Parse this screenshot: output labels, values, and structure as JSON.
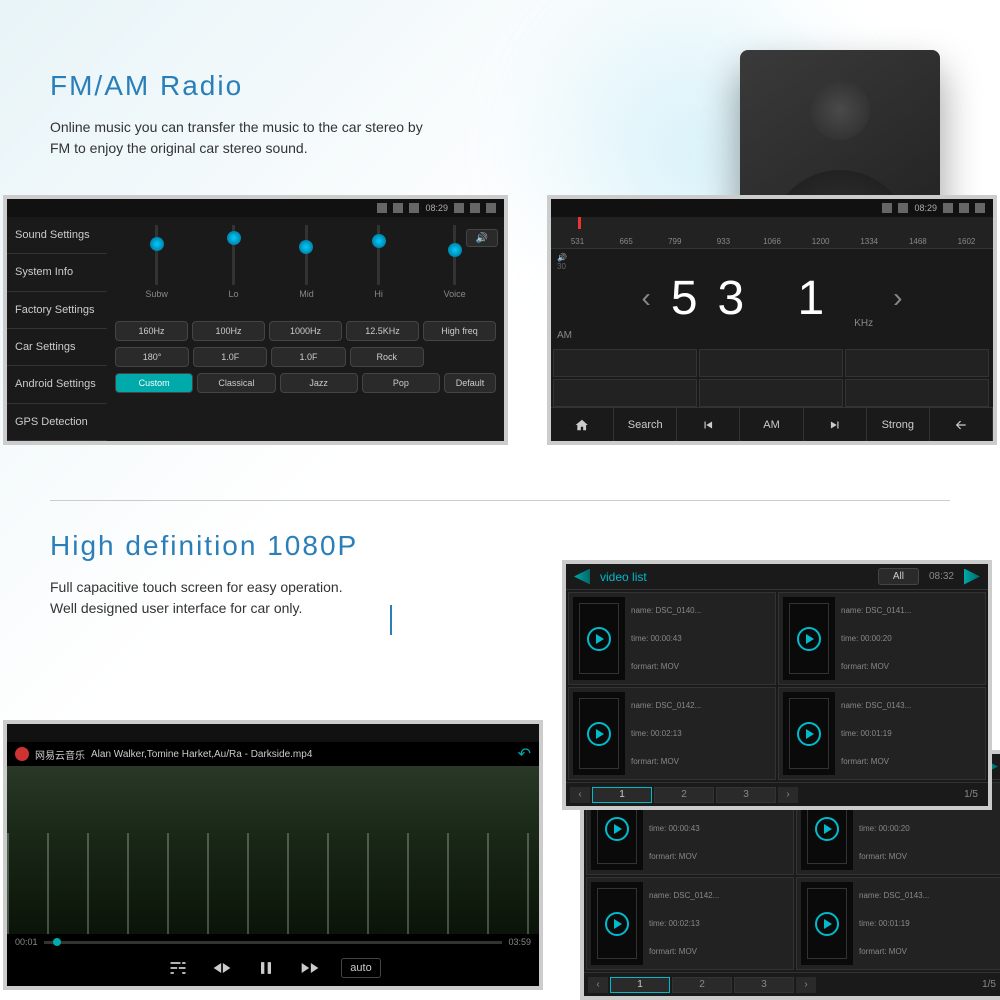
{
  "section1": {
    "title": "FM/AM Radio",
    "desc": "Online music you can transfer the music to the car stereo by FM to enjoy the original car stereo sound."
  },
  "section2": {
    "title": "High definition 1080P",
    "desc": "Full capacitive touch screen for easy operation.\nWell designed user interface for car only."
  },
  "status": {
    "time": "08:29"
  },
  "eq": {
    "side": [
      "Sound Settings",
      "System Info",
      "Factory Settings",
      "Car Settings",
      "Android Settings",
      "GPS Detection"
    ],
    "sliders": [
      "Subw",
      "Lo",
      "Mid",
      "Hi",
      "Voice"
    ],
    "row1": [
      "160Hz",
      "100Hz",
      "1000Hz",
      "12.5KHz",
      "High freq"
    ],
    "row2": [
      "180°",
      "1.0F",
      "1.0F",
      "Rock"
    ],
    "row3": [
      "Custom",
      "Classical",
      "Jazz",
      "Pop"
    ],
    "default": "Default"
  },
  "radio": {
    "ticks": [
      "531",
      "665",
      "799",
      "933",
      "1066",
      "1200",
      "1334",
      "1468",
      "1602"
    ],
    "vol": "30",
    "band": "AM",
    "freq": "53 1",
    "unit": "KHz",
    "controls": {
      "search": "Search",
      "am": "AM",
      "strong": "Strong"
    }
  },
  "video": {
    "brand": "网易云音乐",
    "title": "Alan Walker,Tomine Harket,Au/Ra - Darkside.mp4",
    "t1": "00:01",
    "t2": "03:59",
    "auto": "auto"
  },
  "list": {
    "title": "video list",
    "all": "All",
    "time": "08:32",
    "items": [
      {
        "name": "name: DSC_0140...",
        "time": "time:  00:00:43",
        "fmt": "formart:  MOV"
      },
      {
        "name": "name: DSC_0141...",
        "time": "time:  00:00:20",
        "fmt": "formart:  MOV"
      },
      {
        "name": "name: DSC_0142...",
        "time": "time:  00:02:13",
        "fmt": "formart:  MOV"
      },
      {
        "name": "name: DSC_0143...",
        "time": "time:  00:01:19",
        "fmt": "formart:  MOV"
      }
    ],
    "pages": [
      "1",
      "2",
      "3"
    ],
    "count": "1/5"
  }
}
